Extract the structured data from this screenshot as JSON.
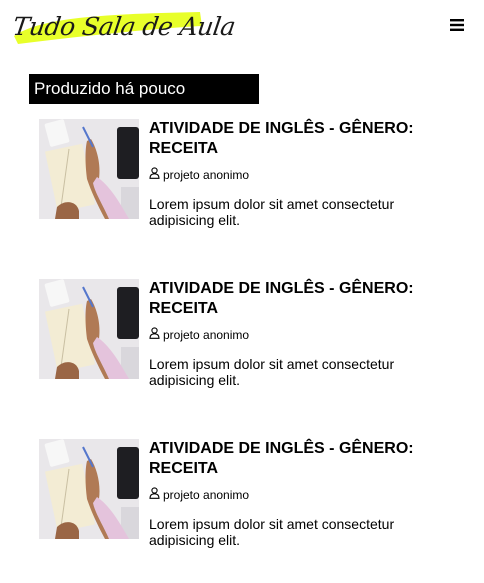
{
  "header": {
    "logo_text": "Tudo Sala de Aula",
    "logo_highlight_color": "#e8ff2a",
    "menu_icon": "hamburger-menu-icon"
  },
  "section": {
    "title": "Produzido há pouco"
  },
  "posts": [
    {
      "title": "ATIVIDADE DE INGLÊS - GÊNERO: RECEITA",
      "author": "projeto anonimo",
      "author_icon": "user-icon",
      "excerpt": "Lorem ipsum dolor sit amet consectetur adipisicing elit."
    },
    {
      "title": "ATIVIDADE DE INGLÊS - GÊNERO: RECEITA",
      "author": "projeto anonimo",
      "author_icon": "user-icon",
      "excerpt": "Lorem ipsum dolor sit amet consectetur adipisicing elit."
    },
    {
      "title": "ATIVIDADE DE INGLÊS - GÊNERO: RECEITA",
      "author": "projeto anonimo",
      "author_icon": "user-icon",
      "excerpt": "Lorem ipsum dolor sit amet consectetur adipisicing elit."
    }
  ]
}
